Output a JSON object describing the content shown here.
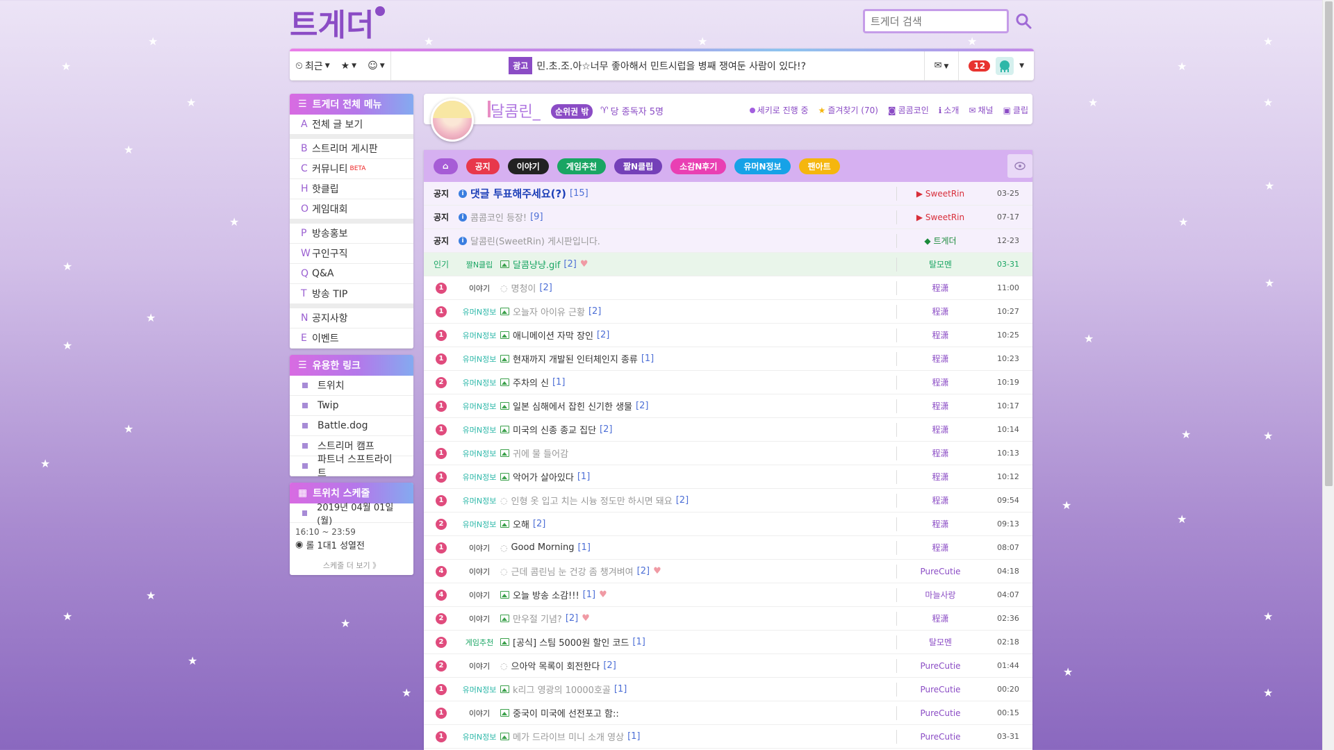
{
  "site": {
    "logo_text": "트게더",
    "search_placeholder": "트게더 검색"
  },
  "topbar": {
    "recent_label": "최근",
    "ad_badge": "광고",
    "ad_text": "민.초.조.아☆너무 좋아해서 민트시럽을 병째 쟁여둔 사람이 있다!?",
    "notification_count": "12"
  },
  "sidebar": {
    "menu_title": "트게더 전체 메뉴",
    "menu_groups": [
      [
        {
          "key": "A",
          "label": "전체 글 보기"
        }
      ],
      [
        {
          "key": "B",
          "label": "스트리머 게시판"
        },
        {
          "key": "C",
          "label": "커뮤니티",
          "badge": "BETA"
        },
        {
          "key": "H",
          "label": "핫클립"
        },
        {
          "key": "O",
          "label": "게임대회"
        }
      ],
      [
        {
          "key": "P",
          "label": "방송홍보"
        },
        {
          "key": "W",
          "label": "구인구직"
        },
        {
          "key": "Q",
          "label": "Q&A"
        },
        {
          "key": "T",
          "label": "방송 TIP"
        }
      ],
      [
        {
          "key": "N",
          "label": "공지사항"
        },
        {
          "key": "E",
          "label": "이벤트"
        }
      ]
    ],
    "links_title": "유용한 링크",
    "links": [
      "트위치",
      "Twip",
      "Battle.dog",
      "스트리머 캠프",
      "파트너 스프트라이트"
    ],
    "schedule_title": "트위치 스케줄",
    "schedule_date": "2019년 04월 01일 (월)",
    "schedule_time": "16:10 ~ 23:59",
    "schedule_event": "롤 1대1 성열전",
    "schedule_more": "스케줄 더 보기 》"
  },
  "channel": {
    "name": "달콤린_",
    "rank": "순위권 밖",
    "subscribers": "당 종독자 5명",
    "links": [
      "세키로 진행 중",
      "즐겨찾기 (70)",
      "콤콤코인",
      "소개",
      "채널",
      "클립"
    ]
  },
  "categories": [
    {
      "label": "",
      "color": "#a65cd6"
    },
    {
      "label": "공지",
      "color": "#e8384b"
    },
    {
      "label": "이야기",
      "color": "#222222"
    },
    {
      "label": "게임추천",
      "color": "#19a563"
    },
    {
      "label": "짤N클립",
      "color": "#7440b8"
    },
    {
      "label": "소감N후기",
      "color": "#e93fb3"
    },
    {
      "label": "유머N정보",
      "color": "#16a2e7"
    },
    {
      "label": "팬아트",
      "color": "#f5b60e"
    }
  ],
  "notices": [
    {
      "label": "공지",
      "title": "댓글 투표해주세요(?)",
      "comments": "[15]",
      "author": "SweetRin",
      "date": "03-25",
      "style": "bold"
    },
    {
      "label": "공지",
      "title": "콤콤코인 등장!",
      "comments": "[9]",
      "author": "SweetRin",
      "date": "07-17",
      "style": "muted"
    },
    {
      "label": "공지",
      "title": "달콤린(SweetRin) 게시판입니다.",
      "comments": "",
      "author": "트게더",
      "date": "12-23",
      "style": "muted"
    }
  ],
  "popular": {
    "label": "인기",
    "category": "짤N클립",
    "title": "달콤냥냥.gif",
    "comments": "[2]",
    "author": "탈모멘",
    "date": "03-31"
  },
  "posts": [
    {
      "level": "1",
      "category": "이야기",
      "title": "명청이",
      "comments": "[2]",
      "author": "程潇",
      "date": "11:00",
      "icon": "chat",
      "muted": true,
      "heart": false,
      "cat_color": "#333333"
    },
    {
      "level": "1",
      "category": "유머N정보",
      "title": "오늘자 아이유 근황",
      "comments": "[2]",
      "author": "程潇",
      "date": "10:27",
      "icon": "img",
      "muted": true,
      "heart": false,
      "cat_color": "#2bb7a8"
    },
    {
      "level": "1",
      "category": "유머N정보",
      "title": "애니메이션 자막 장인",
      "comments": "[2]",
      "author": "程潇",
      "date": "10:25",
      "icon": "img",
      "muted": false,
      "heart": false,
      "cat_color": "#2bb7a8"
    },
    {
      "level": "1",
      "category": "유머N정보",
      "title": "현재까지 개발된 인터체인지 종류",
      "comments": "[1]",
      "author": "程潇",
      "date": "10:23",
      "icon": "img",
      "muted": false,
      "heart": false,
      "cat_color": "#2bb7a8"
    },
    {
      "level": "2",
      "category": "유머N정보",
      "title": "주차의 신",
      "comments": "[1]",
      "author": "程潇",
      "date": "10:19",
      "icon": "img",
      "muted": false,
      "heart": false,
      "cat_color": "#2bb7a8"
    },
    {
      "level": "1",
      "category": "유머N정보",
      "title": "일본 심해에서 잡힌 신기한 생물",
      "comments": "[2]",
      "author": "程潇",
      "date": "10:17",
      "icon": "img",
      "muted": false,
      "heart": false,
      "cat_color": "#2bb7a8"
    },
    {
      "level": "1",
      "category": "유머N정보",
      "title": "미국의 신종 종교 집단",
      "comments": "[2]",
      "author": "程潇",
      "date": "10:14",
      "icon": "img",
      "muted": false,
      "heart": false,
      "cat_color": "#2bb7a8"
    },
    {
      "level": "1",
      "category": "유머N정보",
      "title": "귀에 물 들어감",
      "comments": "",
      "author": "程潇",
      "date": "10:13",
      "icon": "img",
      "muted": true,
      "heart": false,
      "cat_color": "#2bb7a8"
    },
    {
      "level": "1",
      "category": "유머N정보",
      "title": "악어가 살아있다",
      "comments": "[1]",
      "author": "程潇",
      "date": "10:12",
      "icon": "img",
      "muted": false,
      "heart": false,
      "cat_color": "#2bb7a8"
    },
    {
      "level": "1",
      "category": "유머N정보",
      "title": "인형 옷 입고 치는 시늉 정도만 하시면 돼요",
      "comments": "[2]",
      "author": "程潇",
      "date": "09:54",
      "icon": "chat",
      "muted": true,
      "heart": false,
      "cat_color": "#2bb7a8"
    },
    {
      "level": "2",
      "category": "유머N정보",
      "title": "오해",
      "comments": "[2]",
      "author": "程潇",
      "date": "09:13",
      "icon": "img",
      "muted": false,
      "heart": false,
      "cat_color": "#2bb7a8"
    },
    {
      "level": "1",
      "category": "이야기",
      "title": "Good Morning",
      "comments": "[1]",
      "author": "程潇",
      "date": "08:07",
      "icon": "chat",
      "muted": false,
      "heart": false,
      "cat_color": "#333333"
    },
    {
      "level": "4",
      "category": "이야기",
      "title": "근데 콤린님 눈 건강 좀 챙겨벼여",
      "comments": "[2]",
      "author": "PureCutie",
      "date": "04:18",
      "icon": "chat",
      "muted": true,
      "heart": true,
      "cat_color": "#333333"
    },
    {
      "level": "4",
      "category": "이야기",
      "title": "오늘 방송 소감!!!",
      "comments": "[1]",
      "author": "마늘사랑",
      "date": "04:07",
      "icon": "img",
      "muted": false,
      "heart": true,
      "cat_color": "#333333"
    },
    {
      "level": "2",
      "category": "이야기",
      "title": "만우절 기념?",
      "comments": "[2]",
      "author": "程潇",
      "date": "02:36",
      "icon": "img",
      "muted": true,
      "heart": true,
      "cat_color": "#333333"
    },
    {
      "level": "2",
      "category": "게임추천",
      "title": "[공식] 스팀 5000원 할인 코드",
      "comments": "[1]",
      "author": "탈모멘",
      "date": "02:18",
      "icon": "img",
      "muted": false,
      "heart": false,
      "cat_color": "#19a563"
    },
    {
      "level": "2",
      "category": "이야기",
      "title": "으아악 목록이 회전한다",
      "comments": "[2]",
      "author": "PureCutie",
      "date": "01:44",
      "icon": "chat",
      "muted": false,
      "heart": false,
      "cat_color": "#333333"
    },
    {
      "level": "1",
      "category": "유머N정보",
      "title": "k리그 영광의 10000호골",
      "comments": "[1]",
      "author": "PureCutie",
      "date": "00:20",
      "icon": "img",
      "muted": true,
      "heart": false,
      "cat_color": "#2bb7a8"
    },
    {
      "level": "1",
      "category": "이야기",
      "title": "중국이 미국에 선전포고 함::",
      "comments": "",
      "author": "PureCutie",
      "date": "00:15",
      "icon": "img",
      "muted": false,
      "heart": false,
      "cat_color": "#333333"
    },
    {
      "level": "1",
      "category": "유머N정보",
      "title": "메가 드라이브 미니 소개 영상",
      "comments": "[1]",
      "author": "PureCutie",
      "date": "03-31",
      "icon": "img",
      "muted": true,
      "heart": false,
      "cat_color": "#2bb7a8"
    }
  ]
}
